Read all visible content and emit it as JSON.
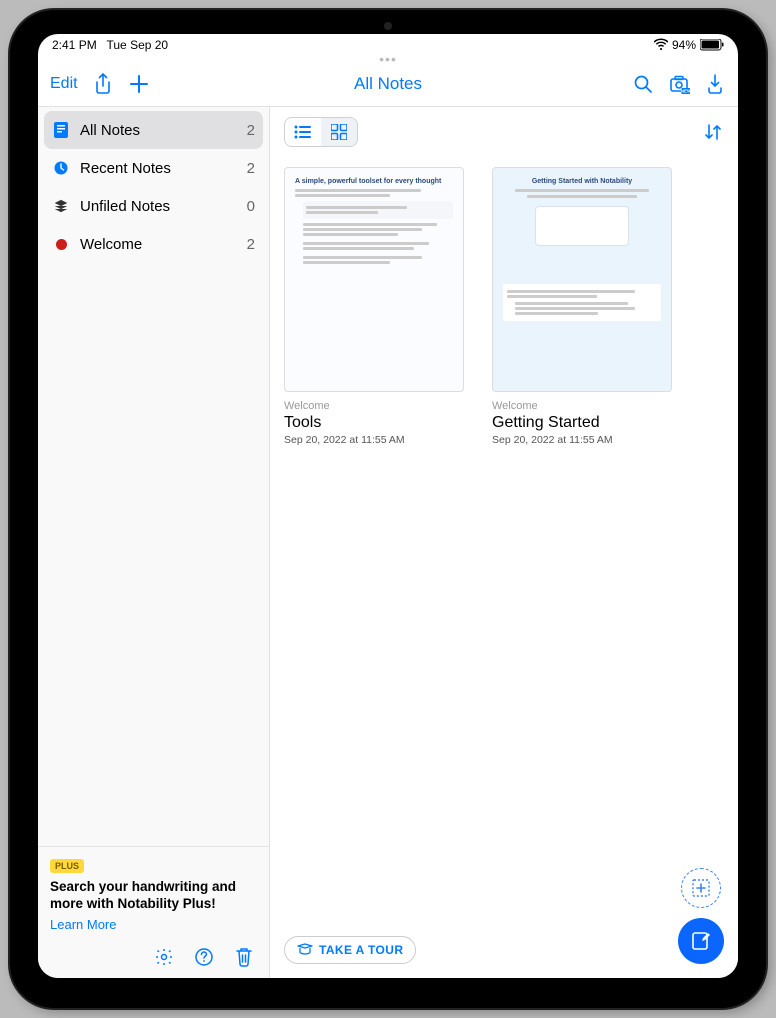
{
  "status": {
    "time": "2:41 PM",
    "date": "Tue Sep 20",
    "battery": "94%"
  },
  "nav": {
    "edit": "Edit",
    "title": "All Notes"
  },
  "sidebar": {
    "items": [
      {
        "label": "All Notes",
        "count": "2"
      },
      {
        "label": "Recent Notes",
        "count": "2"
      },
      {
        "label": "Unfiled Notes",
        "count": "0"
      },
      {
        "label": "Welcome",
        "count": "2"
      }
    ],
    "promo": {
      "badge": "PLUS",
      "text": "Search your handwriting and more with Notability Plus!",
      "learn": "Learn More"
    }
  },
  "notes": [
    {
      "folder": "Welcome",
      "title": "Tools",
      "date": "Sep 20, 2022 at 11:55 AM",
      "thumb_title": "A simple, powerful toolset for every thought"
    },
    {
      "folder": "Welcome",
      "title": "Getting Started",
      "date": "Sep 20, 2022 at 11:55 AM",
      "thumb_title": "Getting Started with Notability"
    }
  ],
  "tour": "TAKE A TOUR"
}
